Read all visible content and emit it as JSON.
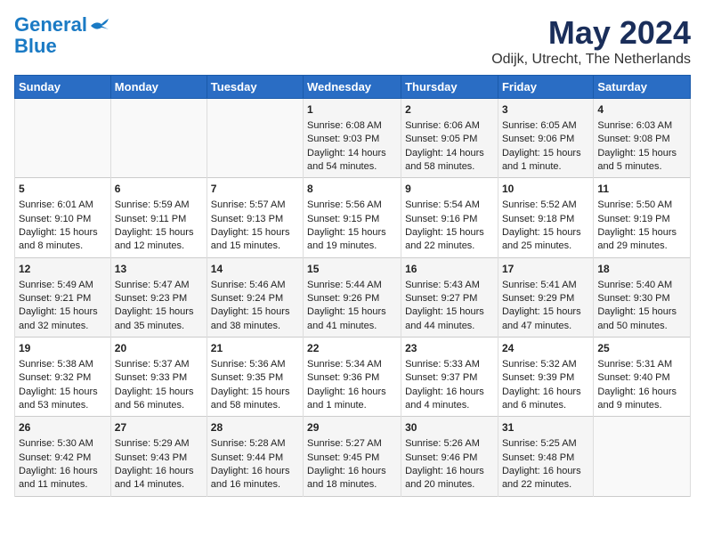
{
  "header": {
    "logo_line1": "General",
    "logo_line2": "Blue",
    "title": "May 2024",
    "subtitle": "Odijk, Utrecht, The Netherlands"
  },
  "days_of_week": [
    "Sunday",
    "Monday",
    "Tuesday",
    "Wednesday",
    "Thursday",
    "Friday",
    "Saturday"
  ],
  "weeks": [
    [
      {
        "day": "",
        "info": ""
      },
      {
        "day": "",
        "info": ""
      },
      {
        "day": "",
        "info": ""
      },
      {
        "day": "1",
        "info": "Sunrise: 6:08 AM\nSunset: 9:03 PM\nDaylight: 14 hours and 54 minutes."
      },
      {
        "day": "2",
        "info": "Sunrise: 6:06 AM\nSunset: 9:05 PM\nDaylight: 14 hours and 58 minutes."
      },
      {
        "day": "3",
        "info": "Sunrise: 6:05 AM\nSunset: 9:06 PM\nDaylight: 15 hours and 1 minute."
      },
      {
        "day": "4",
        "info": "Sunrise: 6:03 AM\nSunset: 9:08 PM\nDaylight: 15 hours and 5 minutes."
      }
    ],
    [
      {
        "day": "5",
        "info": "Sunrise: 6:01 AM\nSunset: 9:10 PM\nDaylight: 15 hours and 8 minutes."
      },
      {
        "day": "6",
        "info": "Sunrise: 5:59 AM\nSunset: 9:11 PM\nDaylight: 15 hours and 12 minutes."
      },
      {
        "day": "7",
        "info": "Sunrise: 5:57 AM\nSunset: 9:13 PM\nDaylight: 15 hours and 15 minutes."
      },
      {
        "day": "8",
        "info": "Sunrise: 5:56 AM\nSunset: 9:15 PM\nDaylight: 15 hours and 19 minutes."
      },
      {
        "day": "9",
        "info": "Sunrise: 5:54 AM\nSunset: 9:16 PM\nDaylight: 15 hours and 22 minutes."
      },
      {
        "day": "10",
        "info": "Sunrise: 5:52 AM\nSunset: 9:18 PM\nDaylight: 15 hours and 25 minutes."
      },
      {
        "day": "11",
        "info": "Sunrise: 5:50 AM\nSunset: 9:19 PM\nDaylight: 15 hours and 29 minutes."
      }
    ],
    [
      {
        "day": "12",
        "info": "Sunrise: 5:49 AM\nSunset: 9:21 PM\nDaylight: 15 hours and 32 minutes."
      },
      {
        "day": "13",
        "info": "Sunrise: 5:47 AM\nSunset: 9:23 PM\nDaylight: 15 hours and 35 minutes."
      },
      {
        "day": "14",
        "info": "Sunrise: 5:46 AM\nSunset: 9:24 PM\nDaylight: 15 hours and 38 minutes."
      },
      {
        "day": "15",
        "info": "Sunrise: 5:44 AM\nSunset: 9:26 PM\nDaylight: 15 hours and 41 minutes."
      },
      {
        "day": "16",
        "info": "Sunrise: 5:43 AM\nSunset: 9:27 PM\nDaylight: 15 hours and 44 minutes."
      },
      {
        "day": "17",
        "info": "Sunrise: 5:41 AM\nSunset: 9:29 PM\nDaylight: 15 hours and 47 minutes."
      },
      {
        "day": "18",
        "info": "Sunrise: 5:40 AM\nSunset: 9:30 PM\nDaylight: 15 hours and 50 minutes."
      }
    ],
    [
      {
        "day": "19",
        "info": "Sunrise: 5:38 AM\nSunset: 9:32 PM\nDaylight: 15 hours and 53 minutes."
      },
      {
        "day": "20",
        "info": "Sunrise: 5:37 AM\nSunset: 9:33 PM\nDaylight: 15 hours and 56 minutes."
      },
      {
        "day": "21",
        "info": "Sunrise: 5:36 AM\nSunset: 9:35 PM\nDaylight: 15 hours and 58 minutes."
      },
      {
        "day": "22",
        "info": "Sunrise: 5:34 AM\nSunset: 9:36 PM\nDaylight: 16 hours and 1 minute."
      },
      {
        "day": "23",
        "info": "Sunrise: 5:33 AM\nSunset: 9:37 PM\nDaylight: 16 hours and 4 minutes."
      },
      {
        "day": "24",
        "info": "Sunrise: 5:32 AM\nSunset: 9:39 PM\nDaylight: 16 hours and 6 minutes."
      },
      {
        "day": "25",
        "info": "Sunrise: 5:31 AM\nSunset: 9:40 PM\nDaylight: 16 hours and 9 minutes."
      }
    ],
    [
      {
        "day": "26",
        "info": "Sunrise: 5:30 AM\nSunset: 9:42 PM\nDaylight: 16 hours and 11 minutes."
      },
      {
        "day": "27",
        "info": "Sunrise: 5:29 AM\nSunset: 9:43 PM\nDaylight: 16 hours and 14 minutes."
      },
      {
        "day": "28",
        "info": "Sunrise: 5:28 AM\nSunset: 9:44 PM\nDaylight: 16 hours and 16 minutes."
      },
      {
        "day": "29",
        "info": "Sunrise: 5:27 AM\nSunset: 9:45 PM\nDaylight: 16 hours and 18 minutes."
      },
      {
        "day": "30",
        "info": "Sunrise: 5:26 AM\nSunset: 9:46 PM\nDaylight: 16 hours and 20 minutes."
      },
      {
        "day": "31",
        "info": "Sunrise: 5:25 AM\nSunset: 9:48 PM\nDaylight: 16 hours and 22 minutes."
      },
      {
        "day": "",
        "info": ""
      }
    ]
  ]
}
